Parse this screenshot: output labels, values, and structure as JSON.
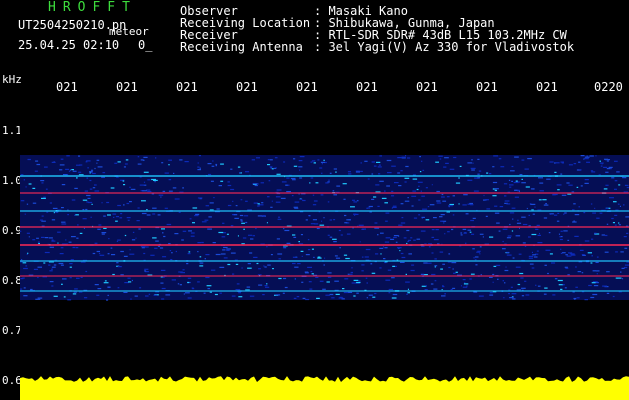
{
  "header": {
    "brand": "HROFFT",
    "filename": "UT2504250210.pn",
    "filename_suffix": "meteor",
    "datetime": "25.04.25 02:10",
    "datetime_extra": "0_",
    "fields": [
      {
        "label": "Observer",
        "value": ": Masaki Kano"
      },
      {
        "label": "Receiving Location",
        "value": ": Shibukawa, Gunma, Japan"
      },
      {
        "label": "Receiver",
        "value": ": RTL-SDR SDR# 43dB L15 103.2MHz CW"
      },
      {
        "label": "Receiving Antenna",
        "value": ": 3el Yagi(V) Az 330 for Vladivostok"
      }
    ]
  },
  "axes": {
    "y_unit": "kHz",
    "x_ticks": [
      "021",
      "021",
      "021",
      "021",
      "021",
      "021",
      "021",
      "021",
      "021",
      "0220"
    ],
    "y_ticks": [
      "1.1",
      "1.0",
      "0.9",
      "0.8",
      "0.7",
      "0.6"
    ]
  },
  "colors": {
    "background": "#000000",
    "brand": "#3ddc3d",
    "signal_low": "#0a1a9a",
    "signal_mid": "#1fc8ff",
    "signal_high": "#ff2a55",
    "level_bar": "#ffff00"
  }
}
